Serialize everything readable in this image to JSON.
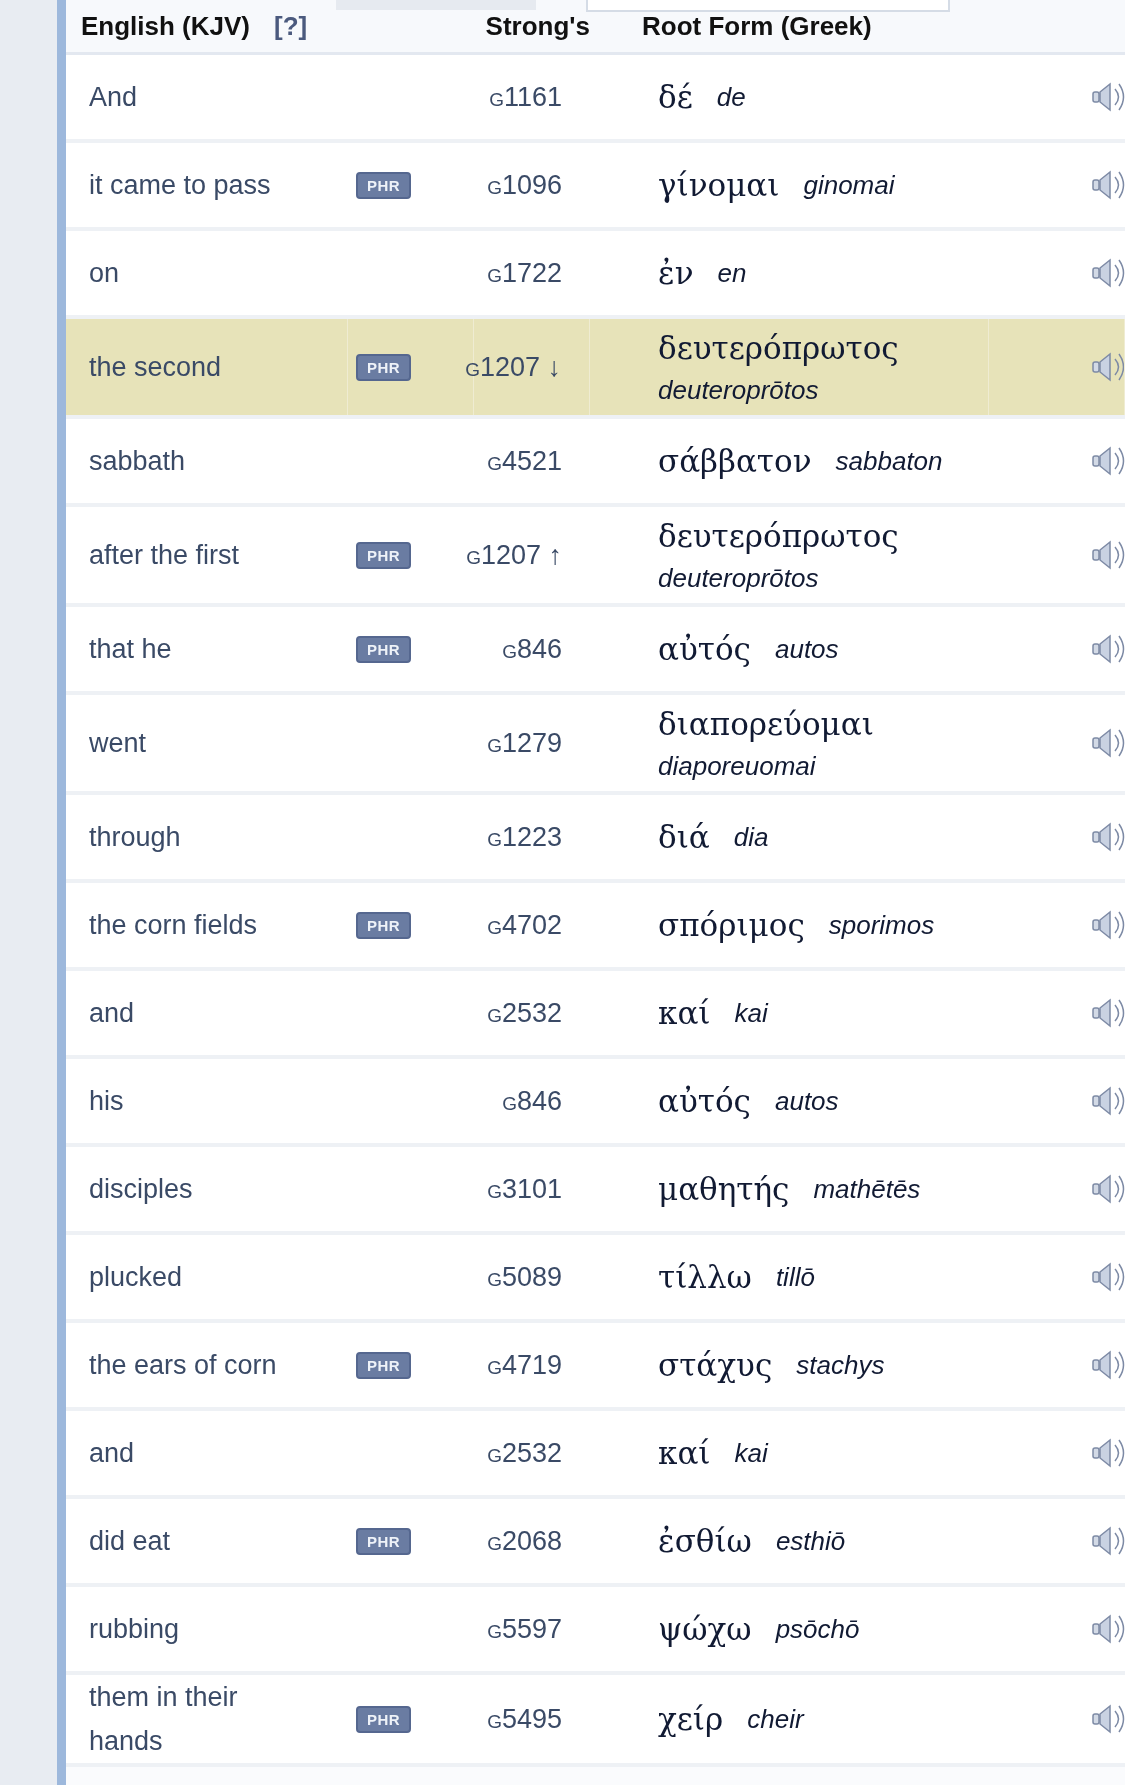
{
  "tabs": [
    {
      "selected": false
    },
    {
      "selected": true
    }
  ],
  "columns": {
    "english": "English (KJV)",
    "help": "[?]",
    "strongs": "Strong's",
    "root": "Root Form (Greek)"
  },
  "rows": [
    {
      "english": "And",
      "strongs": "G1161",
      "greek": "δέ",
      "translit": "de",
      "selected": false
    },
    {
      "english": "it came to pass",
      "badge": "PHR",
      "strongs": "G1096",
      "greek": "γίνομαι",
      "translit": "ginomai",
      "selected": false
    },
    {
      "english": "on",
      "strongs": "G1722",
      "greek": "ἐν",
      "translit": "en",
      "selected": false
    },
    {
      "english": "the second",
      "badge": "PHR",
      "strongs": "G1207 ↓",
      "greek": "δευτερόπρωτος",
      "translit": "deuteroprōtos",
      "selected": true
    },
    {
      "english": "sabbath",
      "strongs": "G4521",
      "greek": "σάββατον",
      "translit": "sabbaton",
      "selected": false
    },
    {
      "english": "after the first",
      "badge": "PHR",
      "strongs": "G1207 ↑",
      "greek": "δευτερόπρωτος",
      "translit": "deuteroprōtos",
      "selected": false
    },
    {
      "english": "that he",
      "badge": "PHR",
      "strongs": "G846",
      "greek": "αὐτός",
      "translit": "autos",
      "selected": false
    },
    {
      "english": "went",
      "strongs": "G1279",
      "greek": "διαπορεύομαι",
      "translit": "diaporeuomai",
      "selected": false
    },
    {
      "english": "through",
      "strongs": "G1223",
      "greek": "διά",
      "translit": "dia",
      "selected": false
    },
    {
      "english": "the corn fields",
      "badge": "PHR",
      "strongs": "G4702",
      "greek": "σπόριμος",
      "translit": "sporimos",
      "selected": false
    },
    {
      "english": "and",
      "strongs": "G2532",
      "greek": "καί",
      "translit": "kai",
      "selected": false
    },
    {
      "english": "his",
      "strongs": "G846",
      "greek": "αὐτός",
      "translit": "autos",
      "selected": false
    },
    {
      "english": "disciples",
      "strongs": "G3101",
      "greek": "μαθητής",
      "translit": "mathētēs",
      "selected": false
    },
    {
      "english": "plucked",
      "strongs": "G5089",
      "greek": "τίλλω",
      "translit": "tillō",
      "selected": false
    },
    {
      "english": "the ears of corn",
      "badge": "PHR",
      "strongs": "G4719",
      "greek": "στάχυς",
      "translit": "stachys",
      "selected": false
    },
    {
      "english": "and",
      "strongs": "G2532",
      "greek": "καί",
      "translit": "kai",
      "selected": false
    },
    {
      "english": "did eat",
      "badge": "PHR",
      "strongs": "G2068",
      "greek": "ἐσθίω",
      "translit": "esthiō",
      "selected": false
    },
    {
      "english": "rubbing",
      "strongs": "G5597",
      "greek": "ψώχω",
      "translit": "psōchō",
      "selected": false
    },
    {
      "english": "them in their hands",
      "badge": "PHR",
      "strongs": "G5495",
      "greek": "χείρ",
      "translit": "cheir",
      "selected": false
    }
  ]
}
